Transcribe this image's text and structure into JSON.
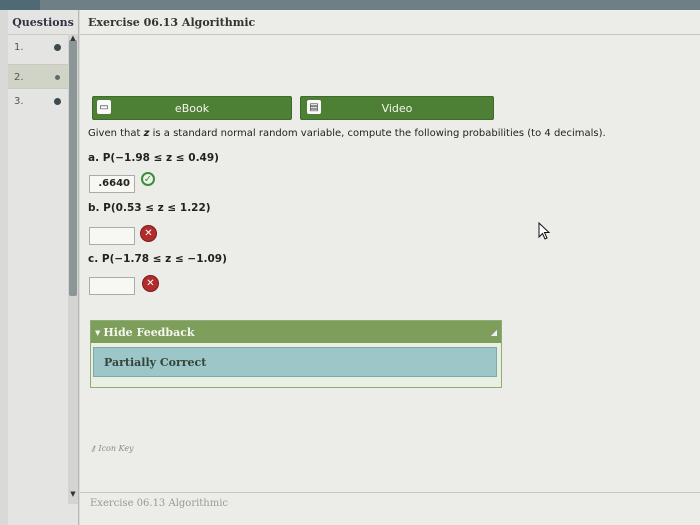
{
  "sidebar": {
    "header": "Questions",
    "items": [
      {
        "number": "1.",
        "status": "answered"
      },
      {
        "number": "2.",
        "status": "current"
      },
      {
        "number": "3.",
        "status": "answered"
      }
    ]
  },
  "exercise": {
    "title": "Exercise 06.13 Algorithmic",
    "footer": "Exercise 06.13 Algorithmic"
  },
  "resources": {
    "ebook_label": "eBook",
    "video_label": "Video",
    "ebook_icon": "book-icon",
    "video_icon": "film-icon"
  },
  "question": {
    "prompt_prefix": "Given that ",
    "prompt_var": "z",
    "prompt_suffix": " is a standard normal random variable, compute the following probabilities (to 4 decimals).",
    "parts": [
      {
        "label": "a. P(−1.98 ≤ z ≤ 0.49)",
        "answer": ".6640",
        "result": "correct"
      },
      {
        "label": "b. P(0.53 ≤ z ≤ 1.22)",
        "answer": "",
        "result": "incorrect"
      },
      {
        "label": "c. P(−1.78 ≤ z ≤ −1.09)",
        "answer": "",
        "result": "incorrect"
      }
    ]
  },
  "feedback": {
    "toggle_label": "Hide Feedback",
    "status": "Partially Correct"
  },
  "icon_key_label": "Icon Key",
  "colors": {
    "button_green": "#4d7f35",
    "feedback_header": "#7e9f5c",
    "feedback_body": "#9dc6c8",
    "correct": "#3c8d3a",
    "incorrect": "#b32c2c"
  }
}
